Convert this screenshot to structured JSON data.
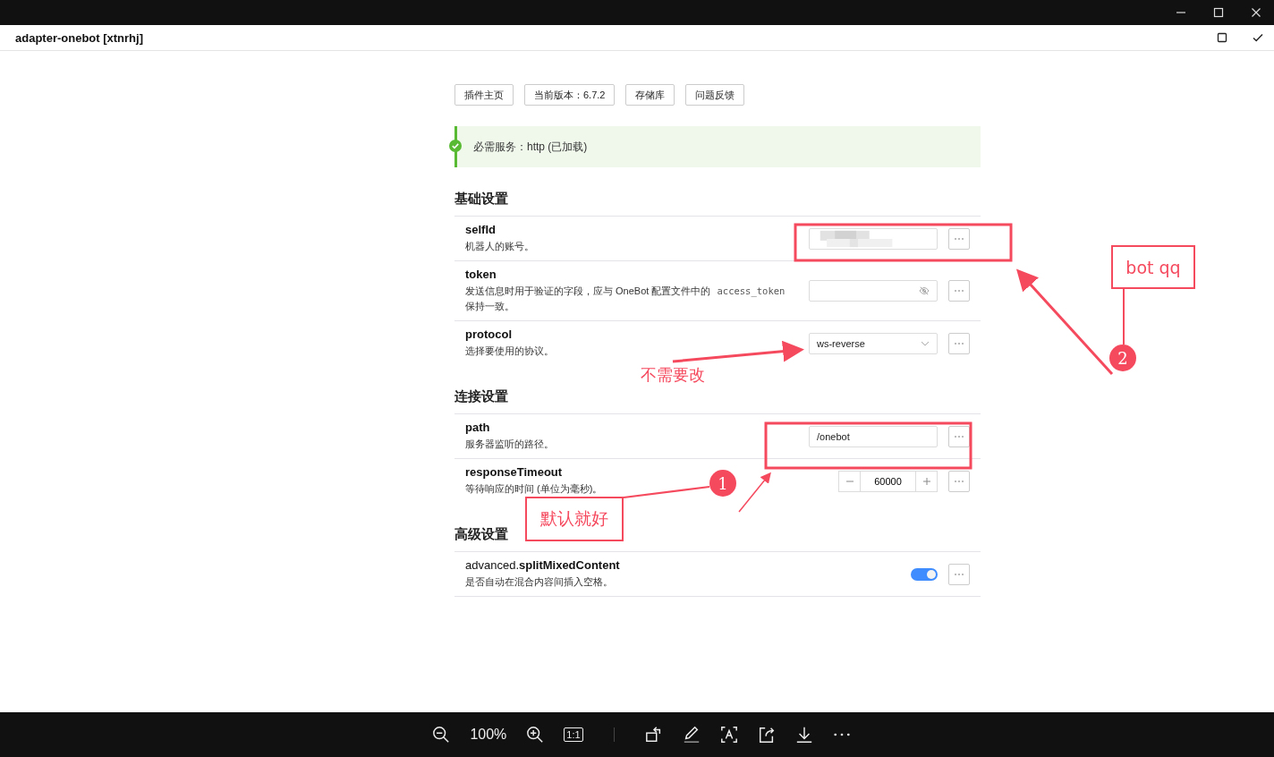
{
  "window": {
    "title": "adapter-onebot [xtnrhj]"
  },
  "links": [
    "插件主页",
    "当前版本：6.7.2",
    "存储库",
    "问题反馈"
  ],
  "notice": {
    "kind": "success",
    "text": "必需服务：http (已加载)"
  },
  "sections": [
    {
      "title": "基础设置",
      "items": [
        {
          "kind": "blurred",
          "name": "selfId",
          "description": [
            {
              "kind": "text",
              "text": "机器人的账号。"
            }
          ]
        },
        {
          "kind": "password",
          "name": "token",
          "description": [
            {
              "kind": "text",
              "text": "发送信息时用于验证的字段，应与 OneBot 配置文件中的 "
            },
            {
              "kind": "code",
              "text": "access_token"
            },
            {
              "kind": "text",
              "text": " 保持一致。"
            }
          ]
        },
        {
          "kind": "select",
          "name": "protocol",
          "value": "ws-reverse",
          "description": [
            {
              "kind": "text",
              "text": "选择要使用的协议。"
            }
          ]
        }
      ]
    },
    {
      "title": "连接设置",
      "items": [
        {
          "kind": "text",
          "name": "path",
          "value": "/onebot",
          "description": [
            {
              "kind": "text",
              "text": "服务器监听的路径。"
            }
          ]
        },
        {
          "kind": "number",
          "name": "responseTimeout",
          "value": "60000",
          "description": [
            {
              "kind": "text",
              "text": "等待响应的时间 (单位为毫秒)。"
            }
          ]
        }
      ]
    },
    {
      "title": "高级设置",
      "items": [
        {
          "kind": "switch",
          "prefix": "advanced.",
          "name": "splitMixedContent",
          "on": true,
          "description": [
            {
              "kind": "text",
              "text": "是否自动在混合内容间插入空格。"
            }
          ]
        }
      ]
    }
  ],
  "annotations": [
    {
      "kind": "label",
      "text": "bot qq"
    },
    {
      "kind": "badge",
      "text": "2"
    },
    {
      "kind": "note",
      "text": "不需要改"
    },
    {
      "kind": "badge",
      "text": "1"
    },
    {
      "kind": "label",
      "text": "默认就好"
    }
  ],
  "viewer": {
    "zoom": "100%",
    "actual_size": "1:1"
  }
}
